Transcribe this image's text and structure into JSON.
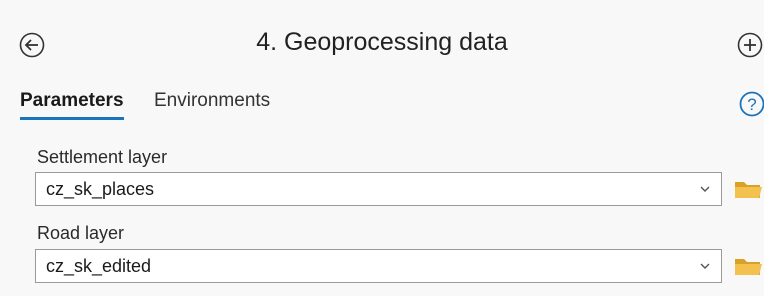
{
  "header": {
    "title": "4. Geoprocessing data",
    "back_icon": "back-arrow-icon",
    "add_icon": "add-circle-icon"
  },
  "tabs": [
    {
      "label": "Parameters",
      "active": true
    },
    {
      "label": "Environments",
      "active": false
    }
  ],
  "help_icon": "help-icon",
  "parameters": [
    {
      "label": "Settlement layer",
      "value": "cz_sk_places"
    },
    {
      "label": "Road layer",
      "value": "cz_sk_edited"
    }
  ],
  "colors": {
    "accent": "#1a75bc",
    "folder": "#e8b53c",
    "background": "#f8f8f8"
  }
}
